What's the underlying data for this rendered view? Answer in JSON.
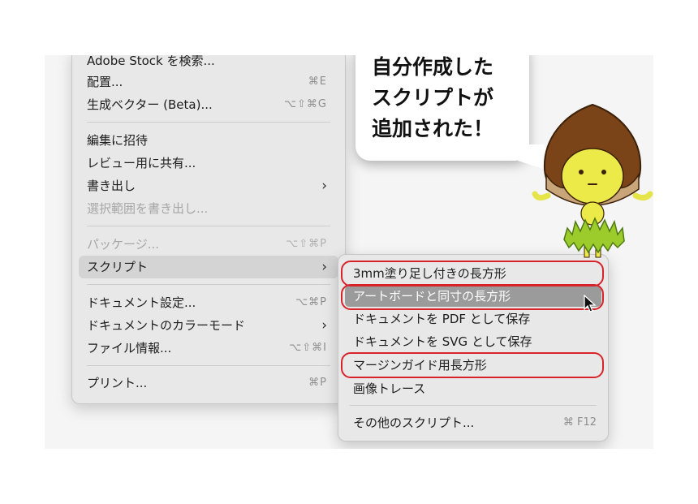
{
  "main_menu": {
    "items": [
      {
        "label": "Adobe Stock を検索...",
        "shortcut": ""
      },
      {
        "label": "配置...",
        "shortcut": "⌘E"
      },
      {
        "label": "生成ベクター (Beta)...",
        "shortcut": "⌥⇧⌘G"
      },
      {
        "label": "編集に招待",
        "shortcut": ""
      },
      {
        "label": "レビュー用に共有...",
        "shortcut": ""
      },
      {
        "label": "書き出し",
        "shortcut": ""
      },
      {
        "label": "選択範囲を書き出し...",
        "shortcut": ""
      },
      {
        "label": "パッケージ...",
        "shortcut": "⌥⇧⌘P"
      },
      {
        "label": "スクリプト",
        "shortcut": ""
      },
      {
        "label": "ドキュメント設定...",
        "shortcut": "⌥⌘P"
      },
      {
        "label": "ドキュメントのカラーモード",
        "shortcut": ""
      },
      {
        "label": "ファイル情報...",
        "shortcut": "⌥⇧⌘I"
      },
      {
        "label": "プリント...",
        "shortcut": "⌘P"
      }
    ],
    "submenu_arrow": "›"
  },
  "script_submenu": {
    "items": [
      {
        "label": "3mm塗り足し付きの長方形"
      },
      {
        "label": "アートボードと同寸の長方形"
      },
      {
        "label": "ドキュメントを PDF として保存"
      },
      {
        "label": "ドキュメントを SVG として保存"
      },
      {
        "label": "マージンガイド用長方形"
      },
      {
        "label": "画像トレース"
      },
      {
        "label": "その他のスクリプト...",
        "shortcut": "⌘ F12"
      }
    ]
  },
  "bubble": {
    "lines": [
      "自分作成した",
      "スクリプトが",
      "追加された！"
    ]
  },
  "colors": {
    "menu_bg": "#e8e8e8",
    "highlight": "#d4d4d4",
    "selected": "#9b9b9b",
    "ring": "#d8232a",
    "chestnut": "#7a4418",
    "mascot_face": "#e8e84a",
    "mascot_skirt": "#9ccc2c"
  },
  "icons": {
    "cursor": "arrow-cursor-icon",
    "mascot": "chestnut-mascot-icon"
  }
}
